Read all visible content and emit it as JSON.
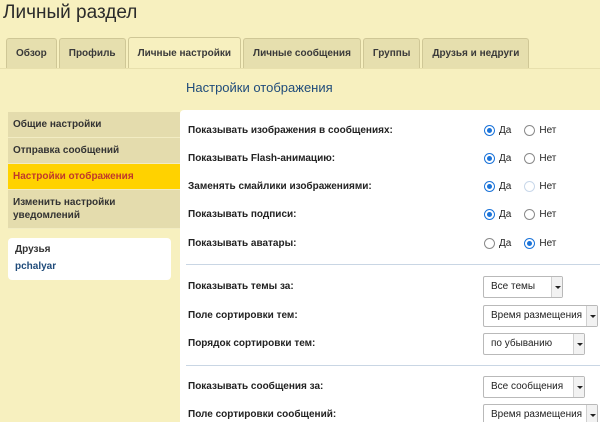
{
  "page": {
    "title": "Личный раздел"
  },
  "tabs": [
    {
      "label": "Обзор"
    },
    {
      "label": "Профиль"
    },
    {
      "label": "Личные настройки",
      "active": true
    },
    {
      "label": "Личные сообщения"
    },
    {
      "label": "Группы"
    },
    {
      "label": "Друзья и недруги"
    }
  ],
  "section": {
    "title": "Настройки отображения"
  },
  "sidebar": {
    "items": [
      {
        "label": "Общие настройки"
      },
      {
        "label": "Отправка сообщений"
      },
      {
        "label": "Настройки отображения",
        "active": true
      },
      {
        "label": "Изменить настройки уведомлений"
      }
    ],
    "friends": {
      "title": "Друзья",
      "items": [
        "pchalyar"
      ]
    }
  },
  "radio_options": {
    "yes": "Да",
    "no": "Нет"
  },
  "settings": [
    {
      "label": "Показывать изображения в сообщениях:",
      "value": "yes"
    },
    {
      "label": "Показывать Flash-анимацию:",
      "value": "yes"
    },
    {
      "label": "Заменять смайлики изображениями:",
      "value": "yes"
    },
    {
      "label": "Показывать подписи:",
      "value": "yes"
    },
    {
      "label": "Показывать аватары:",
      "value": "no"
    }
  ],
  "topic_options": [
    {
      "label": "Показывать темы за:",
      "value": "Все темы"
    },
    {
      "label": "Поле сортировки тем:",
      "value": "Время размещения"
    },
    {
      "label": "Порядок сортировки тем:",
      "value": "по убыванию"
    }
  ],
  "post_options": [
    {
      "label": "Показывать сообщения за:",
      "value": "Все сообщения"
    },
    {
      "label": "Поле сортировки сообщений:",
      "value": "Время размещения"
    }
  ],
  "colors": {
    "accent": "#ffd200",
    "active_text": "#c0392b",
    "link": "#1f4b7a",
    "radio": "#1a73d9"
  }
}
